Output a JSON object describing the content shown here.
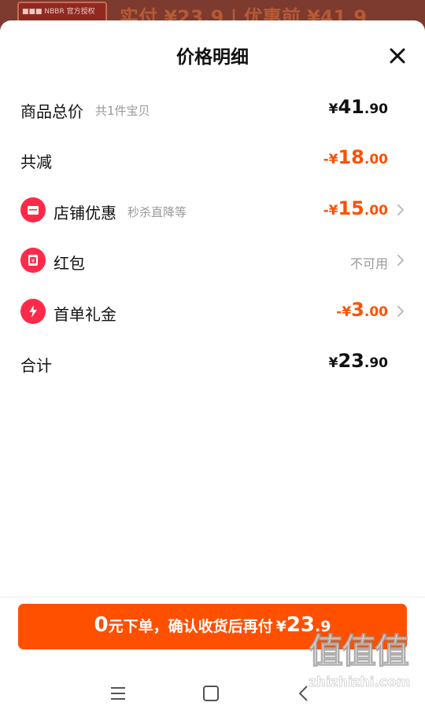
{
  "background": {
    "thumb_label": "■■■ NBBR 官方授权",
    "price_text": "实付 ¥23.9 | 优惠前 ¥41.9"
  },
  "sheet": {
    "title": "价格明细",
    "close_icon": "close-icon"
  },
  "rows": {
    "subtotal": {
      "label": "商品总价",
      "sub": "共1件宝贝",
      "currency": "¥",
      "int": "41",
      "dec": ".90"
    },
    "total_discount": {
      "label": "共减",
      "currency": "-¥",
      "int": "18",
      "dec": ".00"
    },
    "store_discount": {
      "label": "店铺优惠",
      "sub": "秒杀直降等",
      "currency": "-¥",
      "int": "15",
      "dec": ".00",
      "icon": "store-icon"
    },
    "red_packet": {
      "label": "红包",
      "status": "不可用",
      "icon": "red-packet-icon"
    },
    "first_order": {
      "label": "首单礼金",
      "currency": "-¥",
      "int": "3",
      "dec": ".00",
      "icon": "lightning-icon"
    },
    "total": {
      "label": "合计",
      "currency": "¥",
      "int": "23",
      "dec": ".90"
    }
  },
  "cta": {
    "lead_num": "0",
    "text": "元下单，确认收货后再付",
    "currency": "¥",
    "int": "23",
    "dec": ".9"
  },
  "colors": {
    "accent": "#ff5000",
    "badge": "#ff2a4a"
  },
  "watermark": {
    "glyphs": "值值值",
    "site": "zhizhizhi.com"
  }
}
